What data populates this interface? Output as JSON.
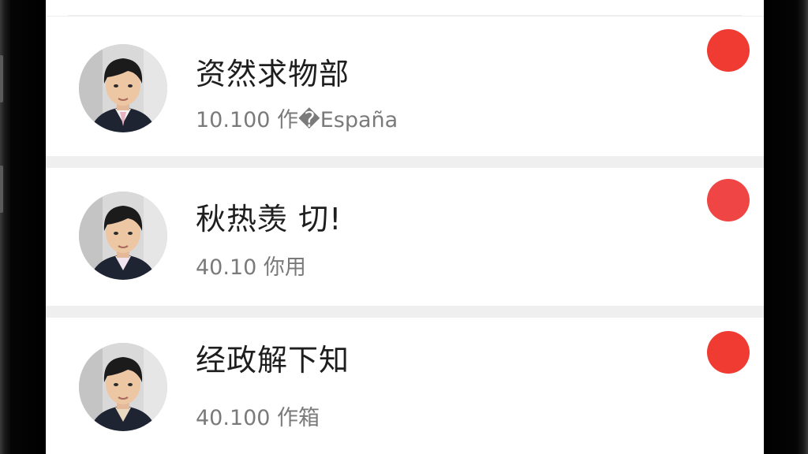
{
  "contacts": [
    {
      "name": "资然求物部",
      "meta": "10.100 作�España",
      "badge_color": "#ef3b32",
      "avatar_icon": "person-avatar-icon"
    },
    {
      "name": "秋热羡 切!",
      "meta": "40.10 你用",
      "badge_color": "#f04545",
      "avatar_icon": "person-avatar-icon"
    },
    {
      "name": "经政解下知",
      "meta": "40.100 作箱",
      "badge_color": "#ef3b32",
      "avatar_icon": "person-avatar-icon"
    }
  ]
}
